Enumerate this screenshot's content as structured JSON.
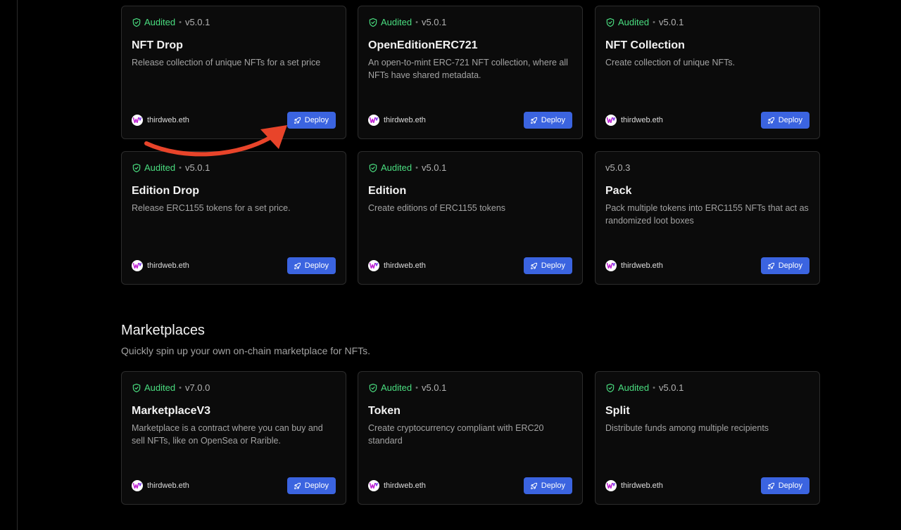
{
  "colors": {
    "background": "#000000",
    "card": "#0b0b0b",
    "card_border": "#2c2c2c",
    "audited": "#4ade80",
    "deploy_button": "#3b64e0",
    "annotation_arrow": "#e8442a"
  },
  "cards": [
    {
      "audited": true,
      "audit_label": "Audited",
      "version": "v5.0.1",
      "title": "NFT Drop",
      "description": "Release collection of unique NFTs for a set price",
      "publisher": "thirdweb.eth",
      "deploy_label": "Deploy"
    },
    {
      "audited": true,
      "audit_label": "Audited",
      "version": "v5.0.1",
      "title": "OpenEditionERC721",
      "description": "An open-to-mint ERC-721 NFT collection, where all NFTs have shared metadata.",
      "publisher": "thirdweb.eth",
      "deploy_label": "Deploy"
    },
    {
      "audited": true,
      "audit_label": "Audited",
      "version": "v5.0.1",
      "title": "NFT Collection",
      "description": "Create collection of unique NFTs.",
      "publisher": "thirdweb.eth",
      "deploy_label": "Deploy"
    },
    {
      "audited": true,
      "audit_label": "Audited",
      "version": "v5.0.1",
      "title": "Edition Drop",
      "description": "Release ERC1155 tokens for a set price.",
      "publisher": "thirdweb.eth",
      "deploy_label": "Deploy"
    },
    {
      "audited": true,
      "audit_label": "Audited",
      "version": "v5.0.1",
      "title": "Edition",
      "description": "Create editions of ERC1155 tokens",
      "publisher": "thirdweb.eth",
      "deploy_label": "Deploy"
    },
    {
      "audited": false,
      "audit_label": "",
      "version": "v5.0.3",
      "title": "Pack",
      "description": "Pack multiple tokens into ERC1155 NFTs that act as randomized loot boxes",
      "publisher": "thirdweb.eth",
      "deploy_label": "Deploy"
    }
  ],
  "marketplaces": {
    "title": "Marketplaces",
    "subtitle": "Quickly spin up your own on-chain marketplace for NFTs.",
    "cards": [
      {
        "audited": true,
        "audit_label": "Audited",
        "version": "v7.0.0",
        "title": "MarketplaceV3",
        "description": "Marketplace is a contract where you can buy and sell NFTs, like on OpenSea or Rarible.",
        "publisher": "thirdweb.eth",
        "deploy_label": "Deploy"
      },
      {
        "audited": true,
        "audit_label": "Audited",
        "version": "v5.0.1",
        "title": "Token",
        "description": "Create cryptocurrency compliant with ERC20 standard",
        "publisher": "thirdweb.eth",
        "deploy_label": "Deploy"
      },
      {
        "audited": true,
        "audit_label": "Audited",
        "version": "v5.0.1",
        "title": "Split",
        "description": "Distribute funds among multiple recipients",
        "publisher": "thirdweb.eth",
        "deploy_label": "Deploy"
      }
    ]
  },
  "icons": {
    "audited": "shield-check-icon",
    "deploy": "rocket-icon",
    "publisher": "thirdweb-logo-icon",
    "annotation": "curved-arrow-icon"
  }
}
